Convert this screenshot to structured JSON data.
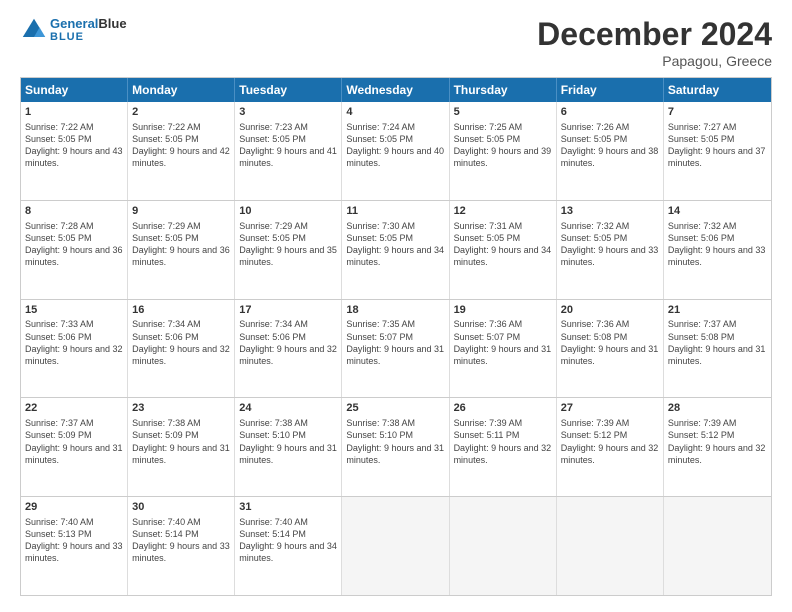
{
  "logo": {
    "text_general": "General",
    "text_blue": "Blue"
  },
  "header": {
    "month": "December 2024",
    "location": "Papagou, Greece"
  },
  "weekdays": [
    "Sunday",
    "Monday",
    "Tuesday",
    "Wednesday",
    "Thursday",
    "Friday",
    "Saturday"
  ],
  "weeks": [
    [
      {
        "day": "1",
        "sunrise": "Sunrise: 7:22 AM",
        "sunset": "Sunset: 5:05 PM",
        "daylight": "Daylight: 9 hours and 43 minutes."
      },
      {
        "day": "2",
        "sunrise": "Sunrise: 7:22 AM",
        "sunset": "Sunset: 5:05 PM",
        "daylight": "Daylight: 9 hours and 42 minutes."
      },
      {
        "day": "3",
        "sunrise": "Sunrise: 7:23 AM",
        "sunset": "Sunset: 5:05 PM",
        "daylight": "Daylight: 9 hours and 41 minutes."
      },
      {
        "day": "4",
        "sunrise": "Sunrise: 7:24 AM",
        "sunset": "Sunset: 5:05 PM",
        "daylight": "Daylight: 9 hours and 40 minutes."
      },
      {
        "day": "5",
        "sunrise": "Sunrise: 7:25 AM",
        "sunset": "Sunset: 5:05 PM",
        "daylight": "Daylight: 9 hours and 39 minutes."
      },
      {
        "day": "6",
        "sunrise": "Sunrise: 7:26 AM",
        "sunset": "Sunset: 5:05 PM",
        "daylight": "Daylight: 9 hours and 38 minutes."
      },
      {
        "day": "7",
        "sunrise": "Sunrise: 7:27 AM",
        "sunset": "Sunset: 5:05 PM",
        "daylight": "Daylight: 9 hours and 37 minutes."
      }
    ],
    [
      {
        "day": "8",
        "sunrise": "Sunrise: 7:28 AM",
        "sunset": "Sunset: 5:05 PM",
        "daylight": "Daylight: 9 hours and 36 minutes."
      },
      {
        "day": "9",
        "sunrise": "Sunrise: 7:29 AM",
        "sunset": "Sunset: 5:05 PM",
        "daylight": "Daylight: 9 hours and 36 minutes."
      },
      {
        "day": "10",
        "sunrise": "Sunrise: 7:29 AM",
        "sunset": "Sunset: 5:05 PM",
        "daylight": "Daylight: 9 hours and 35 minutes."
      },
      {
        "day": "11",
        "sunrise": "Sunrise: 7:30 AM",
        "sunset": "Sunset: 5:05 PM",
        "daylight": "Daylight: 9 hours and 34 minutes."
      },
      {
        "day": "12",
        "sunrise": "Sunrise: 7:31 AM",
        "sunset": "Sunset: 5:05 PM",
        "daylight": "Daylight: 9 hours and 34 minutes."
      },
      {
        "day": "13",
        "sunrise": "Sunrise: 7:32 AM",
        "sunset": "Sunset: 5:05 PM",
        "daylight": "Daylight: 9 hours and 33 minutes."
      },
      {
        "day": "14",
        "sunrise": "Sunrise: 7:32 AM",
        "sunset": "Sunset: 5:06 PM",
        "daylight": "Daylight: 9 hours and 33 minutes."
      }
    ],
    [
      {
        "day": "15",
        "sunrise": "Sunrise: 7:33 AM",
        "sunset": "Sunset: 5:06 PM",
        "daylight": "Daylight: 9 hours and 32 minutes."
      },
      {
        "day": "16",
        "sunrise": "Sunrise: 7:34 AM",
        "sunset": "Sunset: 5:06 PM",
        "daylight": "Daylight: 9 hours and 32 minutes."
      },
      {
        "day": "17",
        "sunrise": "Sunrise: 7:34 AM",
        "sunset": "Sunset: 5:06 PM",
        "daylight": "Daylight: 9 hours and 32 minutes."
      },
      {
        "day": "18",
        "sunrise": "Sunrise: 7:35 AM",
        "sunset": "Sunset: 5:07 PM",
        "daylight": "Daylight: 9 hours and 31 minutes."
      },
      {
        "day": "19",
        "sunrise": "Sunrise: 7:36 AM",
        "sunset": "Sunset: 5:07 PM",
        "daylight": "Daylight: 9 hours and 31 minutes."
      },
      {
        "day": "20",
        "sunrise": "Sunrise: 7:36 AM",
        "sunset": "Sunset: 5:08 PM",
        "daylight": "Daylight: 9 hours and 31 minutes."
      },
      {
        "day": "21",
        "sunrise": "Sunrise: 7:37 AM",
        "sunset": "Sunset: 5:08 PM",
        "daylight": "Daylight: 9 hours and 31 minutes."
      }
    ],
    [
      {
        "day": "22",
        "sunrise": "Sunrise: 7:37 AM",
        "sunset": "Sunset: 5:09 PM",
        "daylight": "Daylight: 9 hours and 31 minutes."
      },
      {
        "day": "23",
        "sunrise": "Sunrise: 7:38 AM",
        "sunset": "Sunset: 5:09 PM",
        "daylight": "Daylight: 9 hours and 31 minutes."
      },
      {
        "day": "24",
        "sunrise": "Sunrise: 7:38 AM",
        "sunset": "Sunset: 5:10 PM",
        "daylight": "Daylight: 9 hours and 31 minutes."
      },
      {
        "day": "25",
        "sunrise": "Sunrise: 7:38 AM",
        "sunset": "Sunset: 5:10 PM",
        "daylight": "Daylight: 9 hours and 31 minutes."
      },
      {
        "day": "26",
        "sunrise": "Sunrise: 7:39 AM",
        "sunset": "Sunset: 5:11 PM",
        "daylight": "Daylight: 9 hours and 32 minutes."
      },
      {
        "day": "27",
        "sunrise": "Sunrise: 7:39 AM",
        "sunset": "Sunset: 5:12 PM",
        "daylight": "Daylight: 9 hours and 32 minutes."
      },
      {
        "day": "28",
        "sunrise": "Sunrise: 7:39 AM",
        "sunset": "Sunset: 5:12 PM",
        "daylight": "Daylight: 9 hours and 32 minutes."
      }
    ],
    [
      {
        "day": "29",
        "sunrise": "Sunrise: 7:40 AM",
        "sunset": "Sunset: 5:13 PM",
        "daylight": "Daylight: 9 hours and 33 minutes."
      },
      {
        "day": "30",
        "sunrise": "Sunrise: 7:40 AM",
        "sunset": "Sunset: 5:14 PM",
        "daylight": "Daylight: 9 hours and 33 minutes."
      },
      {
        "day": "31",
        "sunrise": "Sunrise: 7:40 AM",
        "sunset": "Sunset: 5:14 PM",
        "daylight": "Daylight: 9 hours and 34 minutes."
      },
      null,
      null,
      null,
      null
    ]
  ]
}
